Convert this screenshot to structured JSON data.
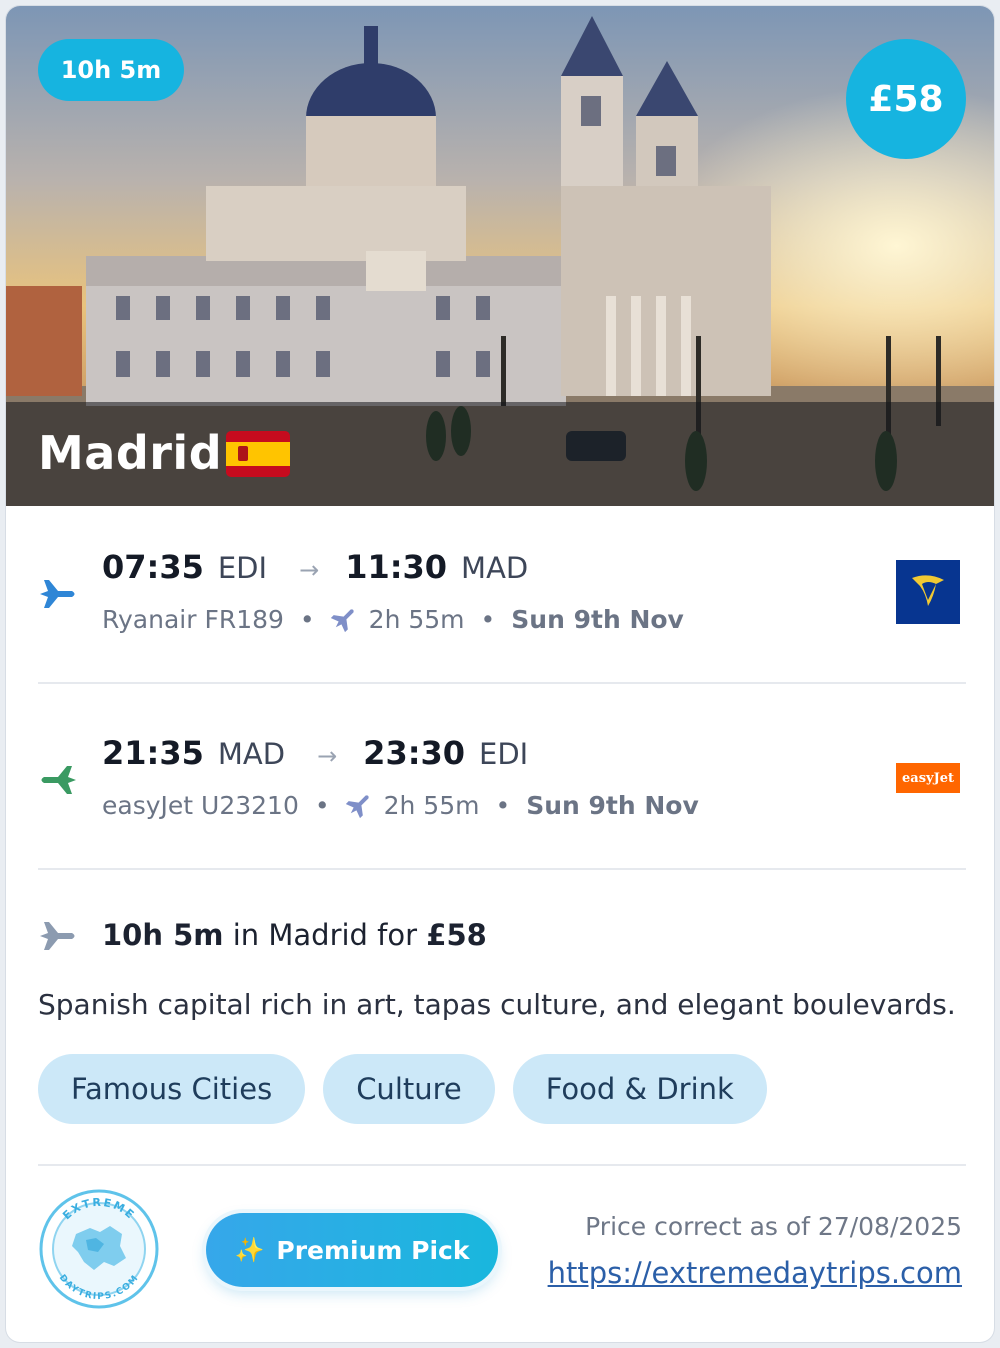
{
  "hero": {
    "duration_badge": "10h 5m",
    "price_badge": "£58",
    "city": "Madrid",
    "flag_icon": "spain-flag-icon"
  },
  "outbound": {
    "depart_time": "07:35",
    "depart_code": "EDI",
    "arrive_time": "11:30",
    "arrive_code": "MAD",
    "airline_flight": "Ryanair FR189",
    "duration": "2h 55m",
    "date": "Sun 9th Nov",
    "airline_logo": "ryanair-logo",
    "icon_color": "#2f86d6"
  },
  "return": {
    "depart_time": "21:35",
    "depart_code": "MAD",
    "arrive_time": "23:30",
    "arrive_code": "EDI",
    "airline_flight": "easyJet U23210",
    "duration": "2h 55m",
    "date": "Sun 9th Nov",
    "airline_logo_text": "easyJet",
    "icon_color": "#3a9a62"
  },
  "summary": {
    "stay_duration": "10h 5m",
    "middle": " in Madrid for ",
    "price": "£58"
  },
  "description": "Spanish capital rich in art, tapas culture, and elegant boulevards.",
  "tags": [
    "Famous Cities",
    "Culture",
    "Food & Drink"
  ],
  "footer": {
    "premium_label": "Premium Pick",
    "price_note": "Price correct as of 27/08/2025",
    "link": "https://extremedaytrips.com",
    "logo_top_text": "EXTREME",
    "logo_bottom_text": "DAYTRIPS.COM"
  },
  "colors": {
    "accent": "#16b4e0",
    "tag_bg": "#cce8f8",
    "link": "#2b5fa8"
  }
}
